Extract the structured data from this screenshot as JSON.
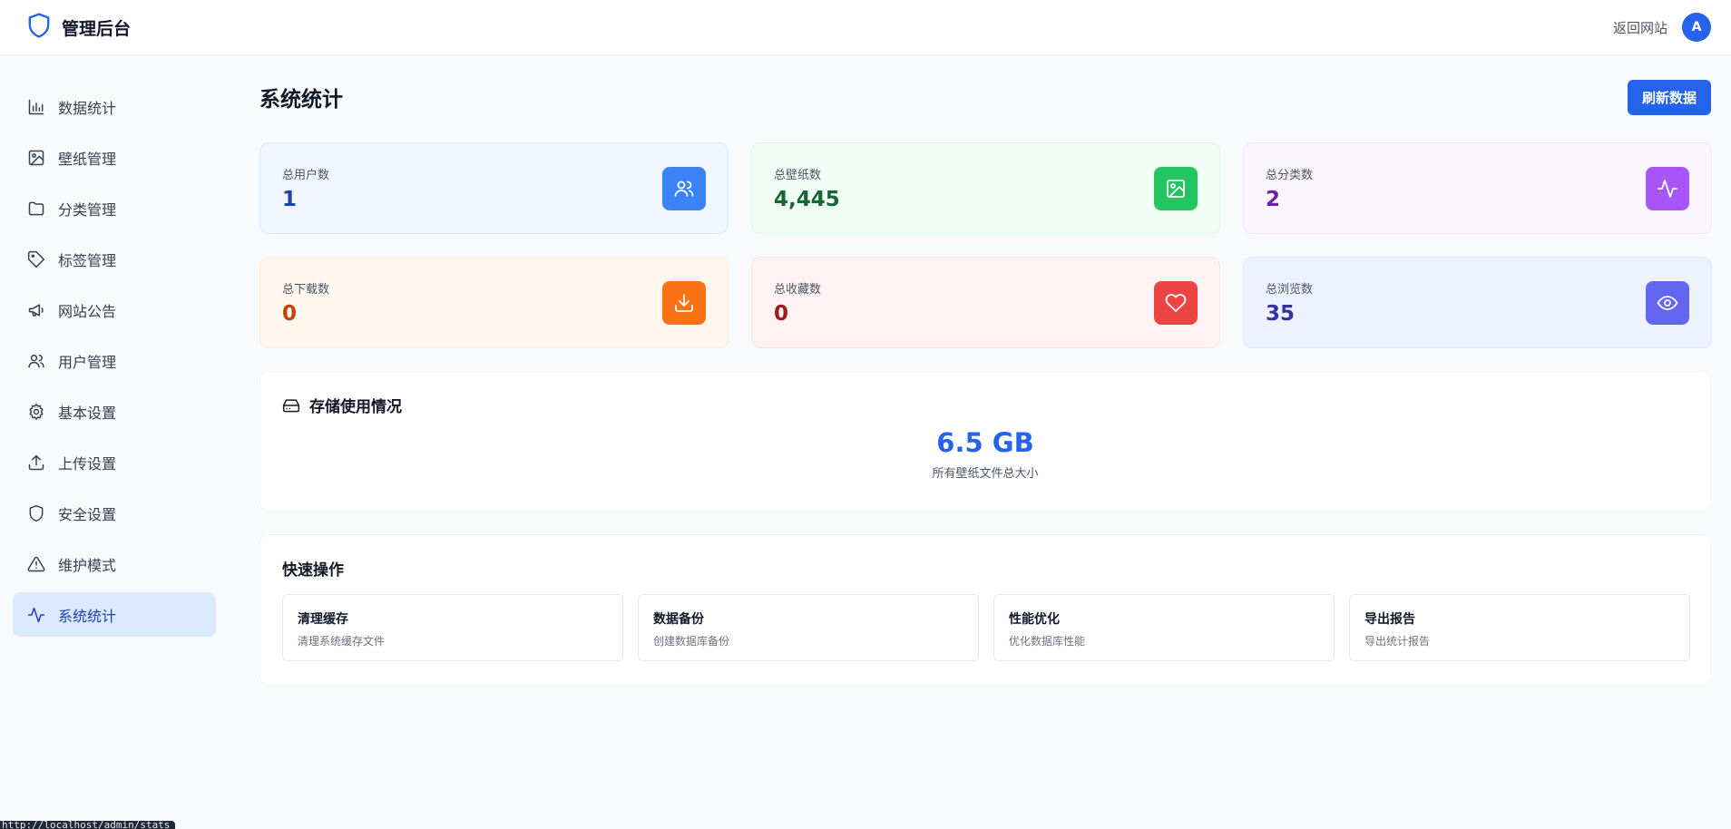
{
  "header": {
    "title": "管理后台",
    "back_link": "返回网站",
    "avatar_letter": "A"
  },
  "sidebar": {
    "items": [
      {
        "label": "数据统计",
        "icon": "bar-chart-icon"
      },
      {
        "label": "壁纸管理",
        "icon": "image-icon"
      },
      {
        "label": "分类管理",
        "icon": "folder-icon"
      },
      {
        "label": "标签管理",
        "icon": "tag-icon"
      },
      {
        "label": "网站公告",
        "icon": "megaphone-icon"
      },
      {
        "label": "用户管理",
        "icon": "users-icon"
      },
      {
        "label": "基本设置",
        "icon": "gear-icon"
      },
      {
        "label": "上传设置",
        "icon": "upload-icon"
      },
      {
        "label": "安全设置",
        "icon": "shield-icon"
      },
      {
        "label": "维护模式",
        "icon": "warning-icon"
      },
      {
        "label": "系统统计",
        "icon": "activity-icon",
        "active": true
      }
    ]
  },
  "page": {
    "title": "系统统计",
    "refresh_label": "刷新数据"
  },
  "stats": [
    {
      "label": "总用户数",
      "value": "1",
      "icon": "users-icon",
      "value_color": "#1e40af",
      "bg": "#eff6ff",
      "border": "#dbeafe",
      "icon_bg": "#3b82f6"
    },
    {
      "label": "总壁纸数",
      "value": "4,445",
      "icon": "image-icon",
      "value_color": "#166534",
      "bg": "#f0fdf4",
      "border": "#dcfce7",
      "icon_bg": "#22c55e"
    },
    {
      "label": "总分类数",
      "value": "2",
      "icon": "activity-icon",
      "value_color": "#6b21a8",
      "bg": "#faf5ff",
      "border": "#f3e8ff",
      "icon_bg": "#a855f7"
    },
    {
      "label": "总下载数",
      "value": "0",
      "icon": "download-icon",
      "value_color": "#c2410c",
      "bg": "#fff7ed",
      "border": "#ffedd5",
      "icon_bg": "#f97316"
    },
    {
      "label": "总收藏数",
      "value": "0",
      "icon": "heart-icon",
      "value_color": "#991b1b",
      "bg": "#fef2f2",
      "border": "#fee2e2",
      "icon_bg": "#ef4444"
    },
    {
      "label": "总浏览数",
      "value": "35",
      "icon": "eye-icon",
      "value_color": "#3730a3",
      "bg": "#eef2ff",
      "border": "#e0e7ff",
      "icon_bg": "#6366f1"
    }
  ],
  "storage": {
    "title": "存储使用情况",
    "value": "6.5 GB",
    "description": "所有壁纸文件总大小"
  },
  "quick_actions": {
    "title": "快速操作",
    "items": [
      {
        "title": "清理缓存",
        "desc": "清理系统缓存文件"
      },
      {
        "title": "数据备份",
        "desc": "创建数据库备份"
      },
      {
        "title": "性能优化",
        "desc": "优化数据库性能"
      },
      {
        "title": "导出报告",
        "desc": "导出统计报告"
      }
    ]
  },
  "status_bar": {
    "url": "http://localhost/admin/stats"
  }
}
